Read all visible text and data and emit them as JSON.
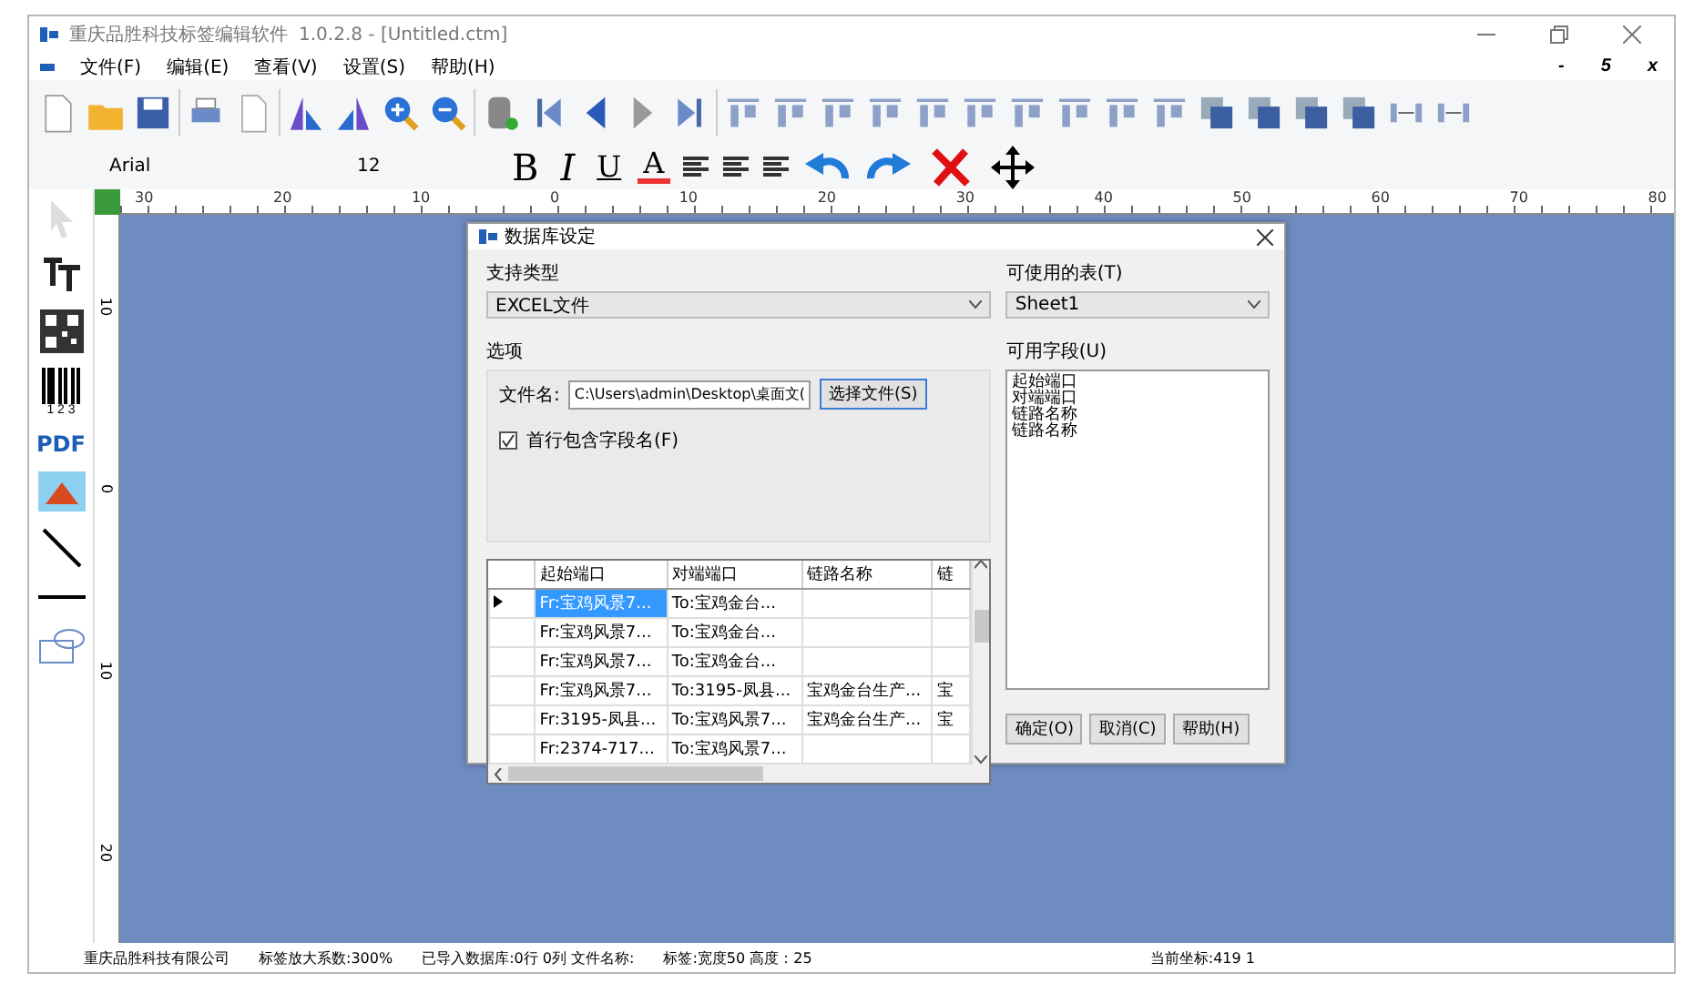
{
  "window": {
    "title": "重庆品胜科技标签编辑软件",
    "version": "1.0.2.8 - [Untitled.ctm]",
    "mdi_controls": [
      "-",
      "5",
      "x"
    ]
  },
  "menu": [
    "文件(F)",
    "编辑(E)",
    "查看(V)",
    "设置(S)",
    "帮助(H)"
  ],
  "format_bar": {
    "font": "Arial",
    "size": "12",
    "bold": "B",
    "italic": "I",
    "underline": "U",
    "font_color_letter": "A"
  },
  "ruler": {
    "top_labels": [
      "30",
      "20",
      "10",
      "0",
      "10",
      "20",
      "30",
      "40",
      "50",
      "60",
      "70",
      "80"
    ],
    "left_labels": [
      "10",
      "0",
      "10",
      "20"
    ]
  },
  "toolbox": [
    {
      "kind": "pointer"
    },
    {
      "kind": "text"
    },
    {
      "kind": "qr"
    },
    {
      "kind": "barcode",
      "label": "1 2 3"
    },
    {
      "kind": "pdf",
      "label": "PDF"
    },
    {
      "kind": "image"
    },
    {
      "kind": "diagonal"
    },
    {
      "kind": "line"
    },
    {
      "kind": "shape"
    }
  ],
  "dialog": {
    "title": "数据库设定",
    "type_label": "支持类型",
    "type_value": "EXCEL文件",
    "table_label": "可使用的表(T)",
    "table_value": "Sheet1",
    "options_label": "选项",
    "file_label": "文件名:",
    "file_value": "C:\\Users\\admin\\Desktop\\桌面文(",
    "choose_button": "选择文件(S)",
    "header_checkbox": {
      "label": "首行包含字段名(F)",
      "checked": true
    },
    "fields_label": "可用字段(U)",
    "fields": [
      "起始端口",
      "对端端口",
      "链路名称",
      "链路名称"
    ],
    "grid": {
      "columns": [
        "起始端口",
        "对端端口",
        "链路名称",
        "链"
      ],
      "rows": [
        {
          "current": true,
          "selected": true,
          "cells": [
            "Fr:宝鸡风景7...",
            "To:宝鸡金台...",
            "",
            ""
          ]
        },
        {
          "current": false,
          "selected": false,
          "cells": [
            "Fr:宝鸡风景7...",
            "To:宝鸡金台...",
            "",
            ""
          ]
        },
        {
          "current": false,
          "selected": false,
          "cells": [
            "Fr:宝鸡风景7...",
            "To:宝鸡金台...",
            "",
            ""
          ]
        },
        {
          "current": false,
          "selected": false,
          "cells": [
            "Fr:宝鸡风景7...",
            "To:3195-凤县...",
            "宝鸡金台生产...",
            "宝"
          ]
        },
        {
          "current": false,
          "selected": false,
          "cells": [
            "Fr:3195-凤县...",
            "To:宝鸡风景7...",
            "宝鸡金台生产...",
            "宝"
          ]
        },
        {
          "current": false,
          "selected": false,
          "cells": [
            "Fr:2374-717...",
            "To:宝鸡风景7...",
            "",
            ""
          ]
        }
      ]
    },
    "buttons": [
      "确定(O)",
      "取消(C)",
      "帮助(H)"
    ]
  },
  "status_bar": [
    "重庆品胜科技有限公司",
    "标签放大系数:300%",
    "已导入数据库:0行 0列 文件名称:",
    "标签:宽度50 高度：25",
    "当前坐标:419 1"
  ]
}
